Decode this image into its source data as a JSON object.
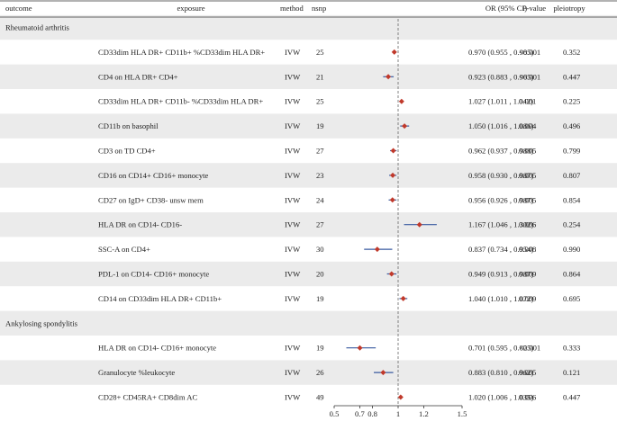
{
  "chart_data": {
    "type": "forest",
    "columns": [
      "outcome",
      "exposure",
      "method",
      "nsnp",
      "OR (95% CI)",
      "P-value",
      "pleiotropy"
    ],
    "groups": [
      {
        "outcome": "Rheumatoid arthritis",
        "rows": [
          {
            "exposure": "CD33dim HLA DR+ CD11b+ %CD33dim HLA DR+",
            "method": "IVW",
            "nsnp": "25",
            "or_text": "0.970 (0.955 , 0.985)",
            "p": "<0.001",
            "pleio": "0.352",
            "or": 0.97,
            "lo": 0.955,
            "hi": 0.985
          },
          {
            "exposure": "CD4 on HLA DR+ CD4+",
            "method": "IVW",
            "nsnp": "21",
            "or_text": "0.923 (0.883 , 0.965)",
            "p": "<0.001",
            "pleio": "0.447",
            "or": 0.923,
            "lo": 0.883,
            "hi": 0.965
          },
          {
            "exposure": "CD33dim HLA DR+ CD11b- %CD33dim HLA DR+",
            "method": "IVW",
            "nsnp": "25",
            "or_text": "1.027 (1.011 , 1.042)",
            "p": "0.001",
            "pleio": "0.225",
            "or": 1.027,
            "lo": 1.011,
            "hi": 1.042
          },
          {
            "exposure": "CD11b on basophil",
            "method": "IVW",
            "nsnp": "19",
            "or_text": "1.050 (1.016 , 1.086)",
            "p": "0.004",
            "pleio": "0.496",
            "or": 1.05,
            "lo": 1.016,
            "hi": 1.086
          },
          {
            "exposure": "CD3 on TD CD4+",
            "method": "IVW",
            "nsnp": "27",
            "or_text": "0.962 (0.937 , 0.988)",
            "p": "0.005",
            "pleio": "0.799",
            "or": 0.962,
            "lo": 0.937,
            "hi": 0.988
          },
          {
            "exposure": "CD16 on CD14+ CD16+ monocyte",
            "method": "IVW",
            "nsnp": "23",
            "or_text": "0.958 (0.930 , 0.987)",
            "p": "0.005",
            "pleio": "0.807",
            "or": 0.958,
            "lo": 0.93,
            "hi": 0.987
          },
          {
            "exposure": "CD27 on IgD+ CD38- unsw mem",
            "method": "IVW",
            "nsnp": "24",
            "or_text": "0.956 (0.926 , 0.987)",
            "p": "0.005",
            "pleio": "0.854",
            "or": 0.956,
            "lo": 0.926,
            "hi": 0.987
          },
          {
            "exposure": "HLA DR on CD14- CD16-",
            "method": "IVW",
            "nsnp": "27",
            "or_text": "1.167 (1.046 , 1.302)",
            "p": "0.006",
            "pleio": "0.254",
            "or": 1.167,
            "lo": 1.046,
            "hi": 1.302
          },
          {
            "exposure": "SSC-A on CD4+",
            "method": "IVW",
            "nsnp": "30",
            "or_text": "0.837 (0.734 , 0.954)",
            "p": "0.008",
            "pleio": "0.990",
            "or": 0.837,
            "lo": 0.734,
            "hi": 0.954
          },
          {
            "exposure": "PDL-1 on CD14- CD16+ monocyte",
            "method": "IVW",
            "nsnp": "20",
            "or_text": "0.949 (0.913 , 0.987)",
            "p": "0.009",
            "pleio": "0.864",
            "or": 0.949,
            "lo": 0.913,
            "hi": 0.987
          },
          {
            "exposure": "CD14  on CD33dim HLA DR+ CD11b+",
            "method": "IVW",
            "nsnp": "19",
            "or_text": "1.040 (1.010 , 1.072)",
            "p": "0.009",
            "pleio": "0.695",
            "or": 1.04,
            "lo": 1.01,
            "hi": 1.072
          }
        ]
      },
      {
        "outcome": "Ankylosing spondylitis",
        "rows": [
          {
            "exposure": "HLA DR on CD14- CD16+ monocyte",
            "method": "IVW",
            "nsnp": "19",
            "or_text": "0.701 (0.595 , 0.825)",
            "p": "<0.001",
            "pleio": "0.333",
            "or": 0.701,
            "lo": 0.595,
            "hi": 0.825
          },
          {
            "exposure": "Granulocyte %leukocyte",
            "method": "IVW",
            "nsnp": "26",
            "or_text": "0.883 (0.810 , 0.962)",
            "p": "0.005",
            "pleio": "0.121",
            "or": 0.883,
            "lo": 0.81,
            "hi": 0.962
          },
          {
            "exposure": "CD28+ CD45RA+ CD8dim AC",
            "method": "IVW",
            "nsnp": "49",
            "or_text": "1.020 (1.006 , 1.035)",
            "p": "0.006",
            "pleio": "0.447",
            "or": 1.02,
            "lo": 1.006,
            "hi": 1.035
          }
        ]
      }
    ],
    "x_ticks": [
      0.5,
      0.7,
      0.8,
      1,
      1.2,
      1.5
    ],
    "x_tick_labels": [
      "0.5",
      "0.7",
      "0.8",
      "1",
      "1.2",
      "1.5"
    ],
    "xlim": [
      0.5,
      1.5
    ],
    "x_scale": "linear",
    "reference_line": 1,
    "colors": {
      "point": "#c0392b",
      "ci_line": "#3a5ba0",
      "stripe": "#ebebeb",
      "reference_line": "#777777"
    }
  }
}
